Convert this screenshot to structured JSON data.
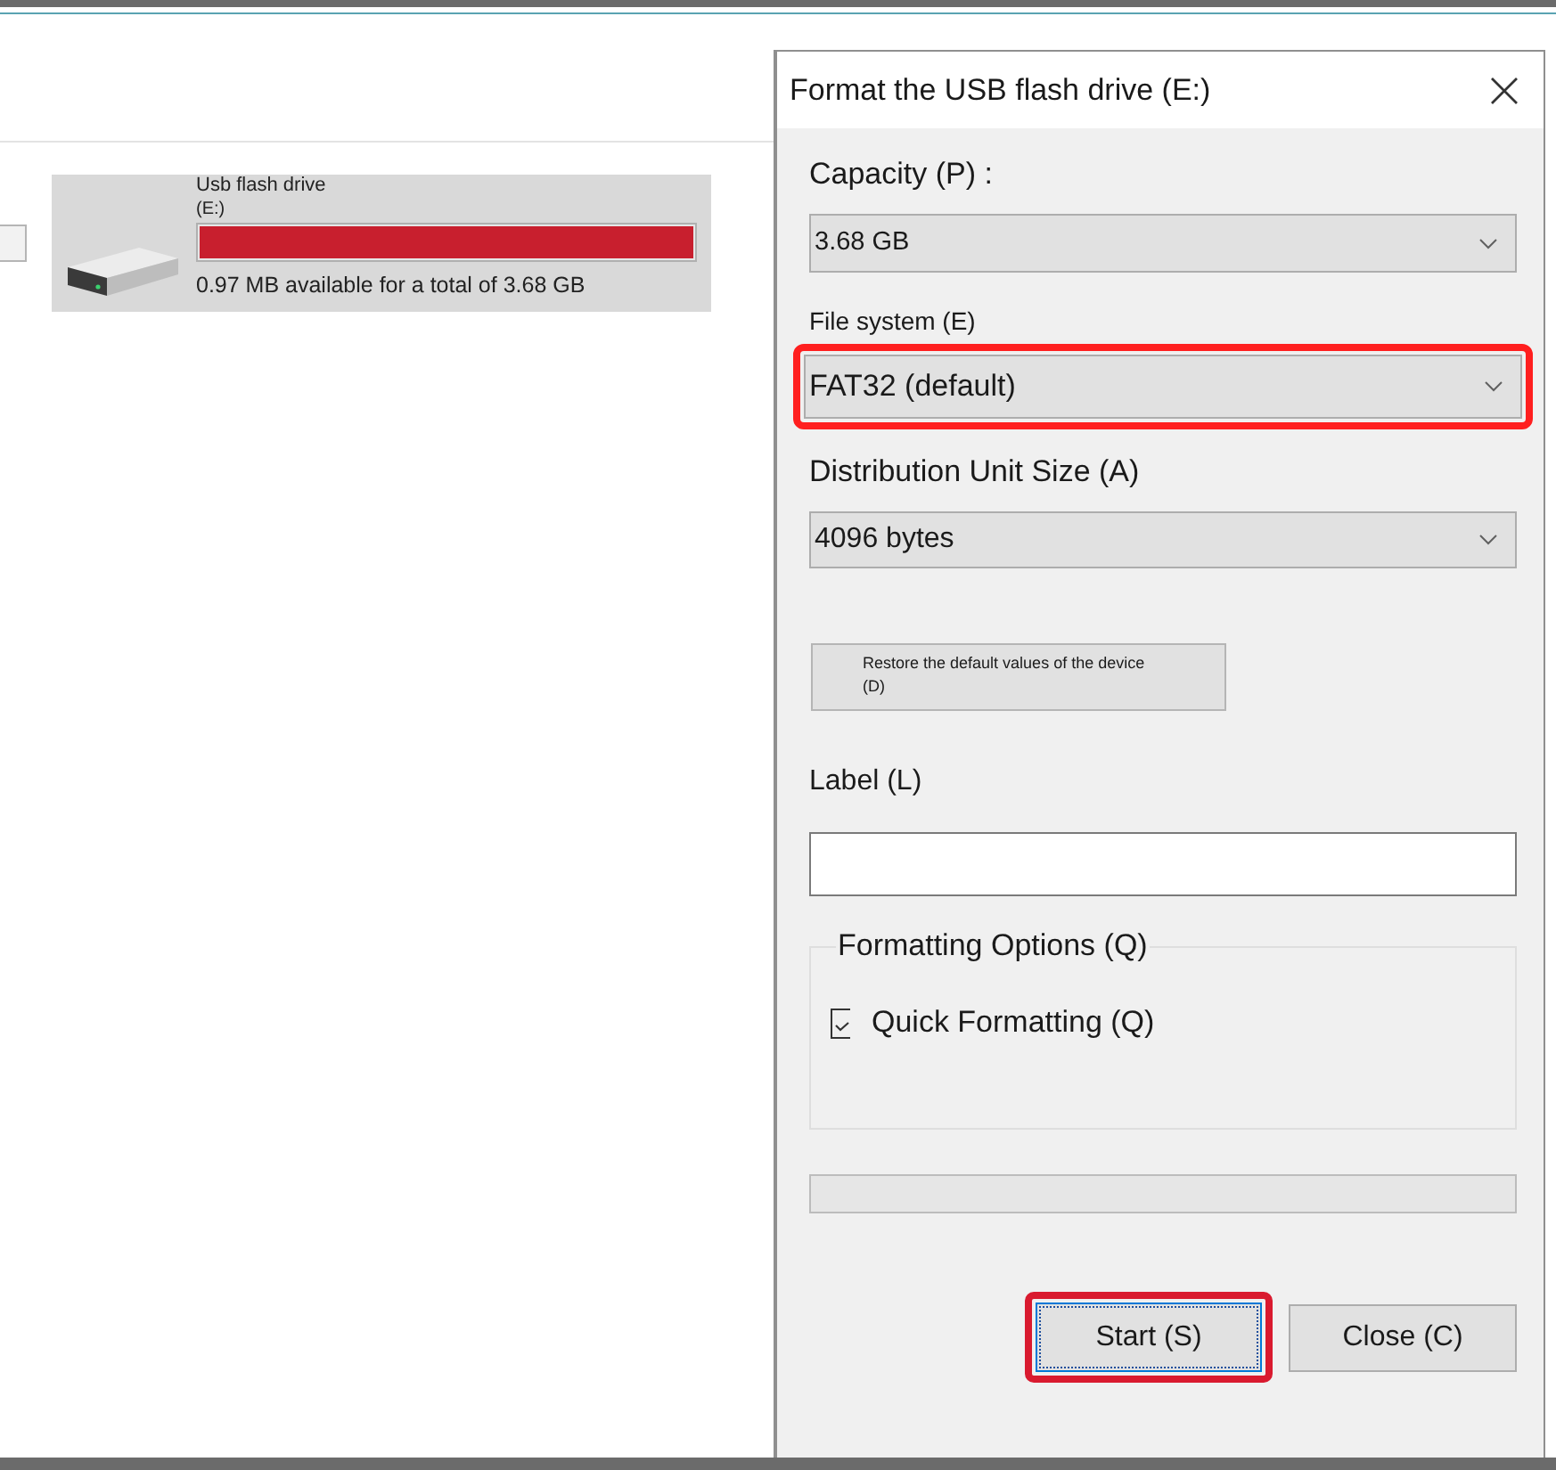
{
  "explorer": {
    "drive": {
      "name": "Usb flash drive",
      "letter": "(E:)",
      "level": 1,
      "space": "0.97 MB available for a total of 3.68 GB"
    }
  },
  "dialog": {
    "title": "Format the USB flash drive (E:)",
    "capacity": {
      "label": "Capacity (P) :",
      "value": "3.68 GB",
      "highlighted": false
    },
    "file_system": {
      "label": "File system (E)",
      "value": "FAT32 (default)",
      "highlighted": true
    },
    "unit_size": {
      "label": "Distribution Unit Size (A)",
      "value": "4096 bytes",
      "highlighted": false
    },
    "restore_button": {
      "label": "Restore the default values of the device (D)"
    },
    "volume_label": {
      "label": "Label (L)"
    },
    "options": {
      "title": "Formatting Options (Q)",
      "items": [
        {
          "label": "Quick Formatting (Q)",
          "checked": true
        }
      ]
    },
    "progress": {
      "level": 0
    },
    "buttons": [
      {
        "label": "Start (S)",
        "focused": true,
        "highlighted": true
      },
      {
        "label": "Close (C)",
        "focused": false,
        "highlighted": false
      }
    ]
  }
}
